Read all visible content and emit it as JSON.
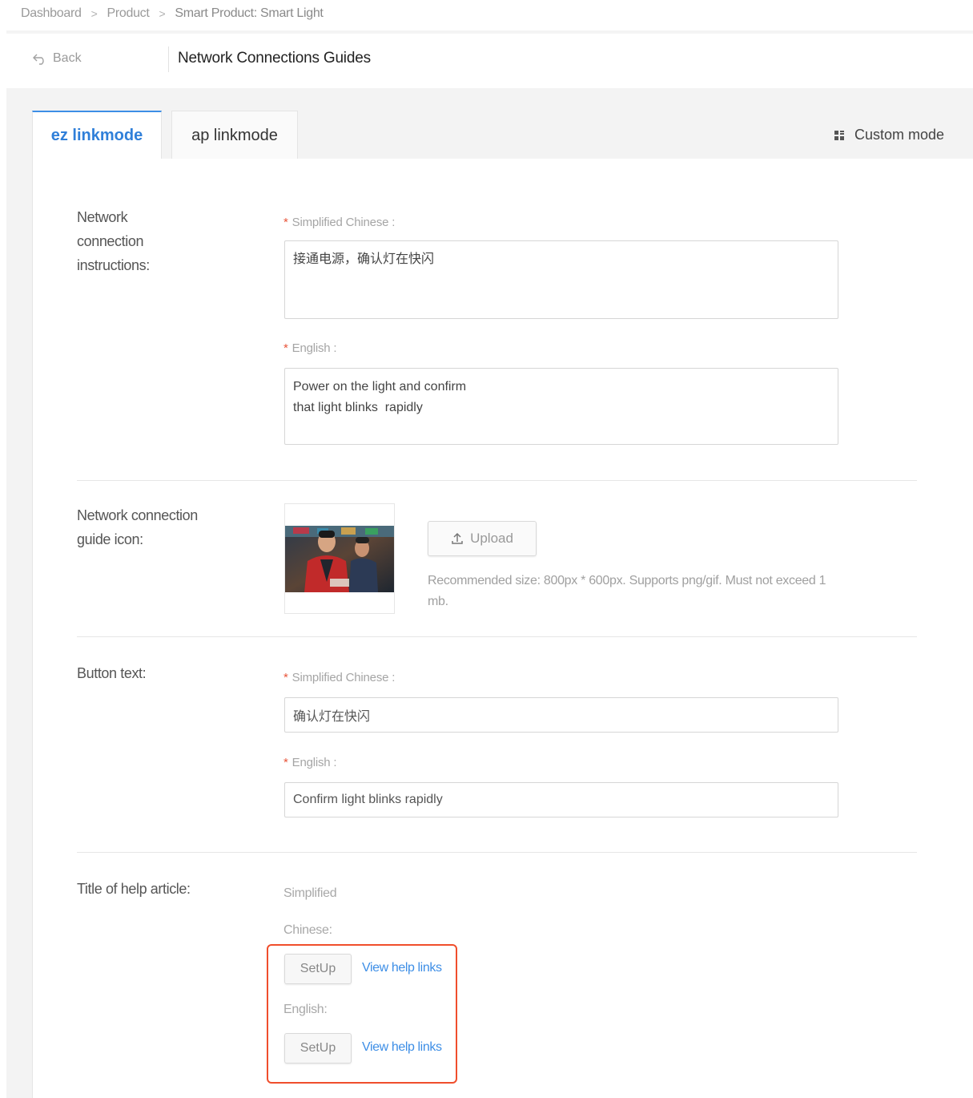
{
  "breadcrumb": {
    "items": [
      "Dashboard",
      "Product",
      "Smart Product: Smart Light"
    ],
    "separator": ">"
  },
  "header": {
    "back_label": "Back",
    "title": "Network Connections Guides"
  },
  "tabs": [
    {
      "label": "ez linkmode",
      "active": true
    },
    {
      "label": "ap linkmode",
      "active": false
    }
  ],
  "custom_mode": {
    "label": "Custom mode",
    "icon": "grid-icon"
  },
  "colors": {
    "accent": "#3d8ee6",
    "required": "#e8553a",
    "highlight": "#f04e2c"
  },
  "instructions": {
    "section_label": "Network connection instructions:",
    "chinese_label": "Simplified Chinese :",
    "chinese_value": "接通电源，确认灯在快闪",
    "english_label": "English :",
    "english_value": "Power on the light and confirm\nthat light blinks  rapidly"
  },
  "guide_icon": {
    "section_label": "Network connection guide icon:",
    "upload_label": "Upload",
    "hint": "Recommended size: 800px * 600px. Supports png/gif. Must not exceed 1 mb."
  },
  "button_text": {
    "section_label": "Button text:",
    "chinese_label": "Simplified Chinese :",
    "chinese_value": "确认灯在快闪",
    "english_label": "English :",
    "english_value": "Confirm light blinks rapidly"
  },
  "help_article": {
    "section_label": "Title of help article:",
    "chinese_label_line1": "Simplified",
    "chinese_label_line2": "Chinese:",
    "english_label": "English:",
    "setup_label": "SetUp",
    "link_label": "View help links"
  }
}
